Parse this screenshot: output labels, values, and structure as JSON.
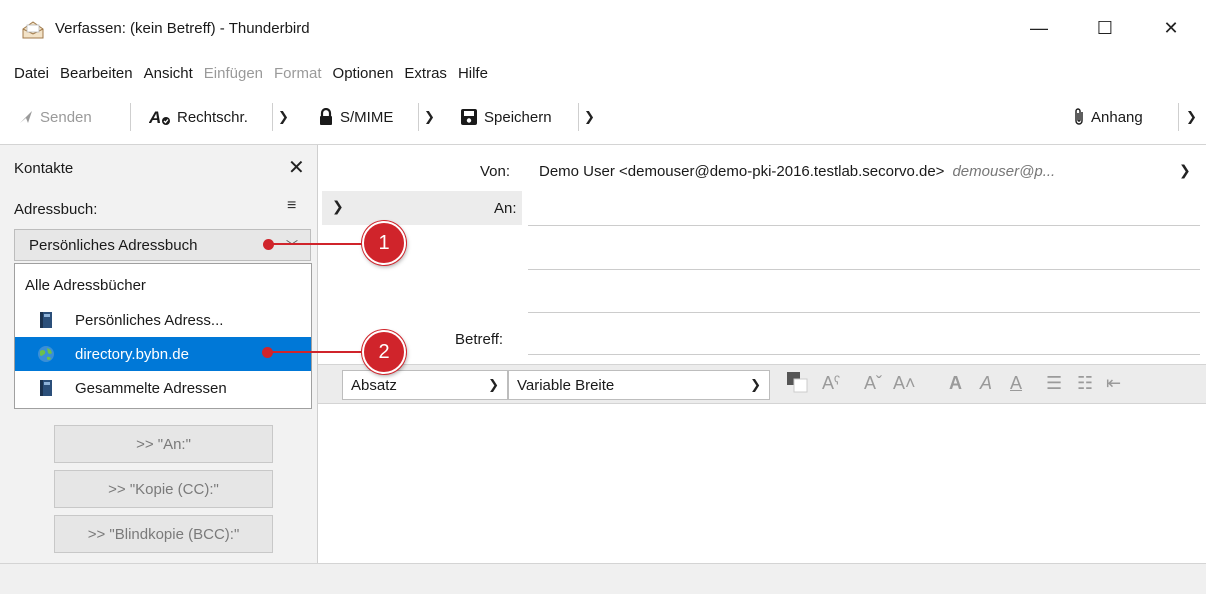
{
  "window": {
    "title": "Verfassen: (kein Betreff) - Thunderbird",
    "minimize": "—",
    "maximize": "☐",
    "close": "✕"
  },
  "menu": [
    "Datei",
    "Bearbeiten",
    "Ansicht",
    "Einfügen",
    "Format",
    "Optionen",
    "Extras",
    "Hilfe"
  ],
  "toolbar": {
    "send": "Senden",
    "spell": "Rechtschr.",
    "smime": "S/MIME",
    "save": "Speichern",
    "attach": "Anhang"
  },
  "sidebar": {
    "title": "Kontakte",
    "addressbook_label": "Adressbuch:",
    "selected": "Persönliches Adressbuch",
    "dropdown": [
      {
        "label": "Alle Adressbücher",
        "icon": "none"
      },
      {
        "label": "Persönliches Adress...",
        "icon": "addressbook-icon"
      },
      {
        "label": "directory.bybn.de",
        "icon": "ldap-globe-icon",
        "selected": true
      },
      {
        "label": "Gesammelte Adressen",
        "icon": "addressbook-icon"
      }
    ],
    "buttons": [
      ">> \"An:\"",
      ">> \"Kopie (CC):\"",
      ">> \"Blindkopie (BCC):\""
    ]
  },
  "header": {
    "from_label": "Von:",
    "from_value": "Demo User <demouser@demo-pki-2016.testlab.secorvo.de>",
    "from_hint": "demouser@p...",
    "to_label": "An:",
    "subject_label": "Betreff:"
  },
  "format": {
    "paragraph": "Absatz",
    "font": "Variable Breite"
  },
  "callouts": [
    "1",
    "2"
  ],
  "colors": {
    "accent": "#0078d7",
    "callout": "#d0242b"
  }
}
